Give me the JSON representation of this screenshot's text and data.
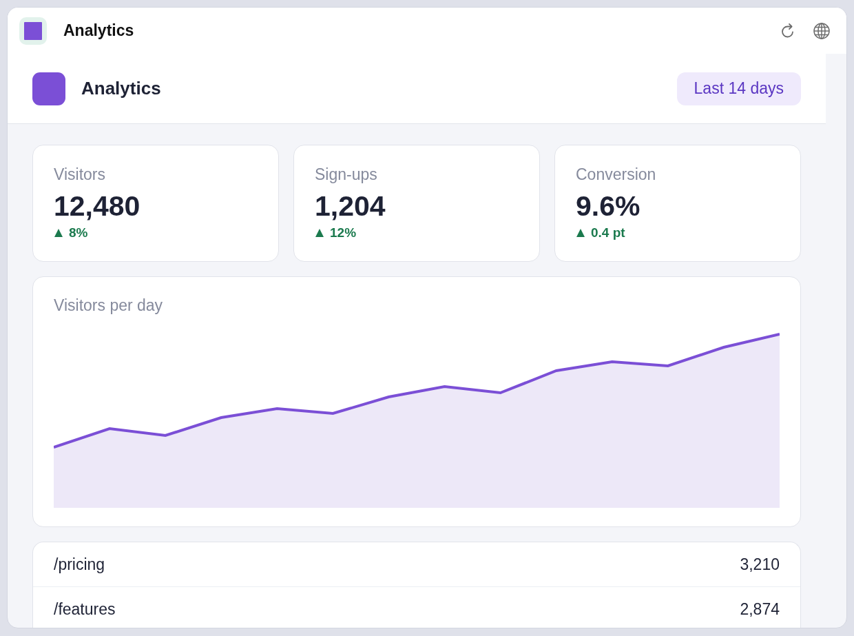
{
  "window": {
    "title": "Analytics"
  },
  "header": {
    "title": "Analytics",
    "range": "Last 14 days"
  },
  "stats": [
    {
      "label": "Visitors",
      "value": "12,480",
      "change": "8%",
      "rising": true
    },
    {
      "label": "Sign-ups",
      "value": "1,204",
      "change": "12%",
      "rising": true
    },
    {
      "label": "Conversion",
      "value": "9.6%",
      "change": "0.4 pt",
      "rising": true
    }
  ],
  "chart": {
    "title": "Visitors per day"
  },
  "table": {
    "rows": [
      {
        "path": "/pricing",
        "count": "3,210"
      },
      {
        "path": "/features",
        "count": "2,874"
      }
    ]
  }
}
